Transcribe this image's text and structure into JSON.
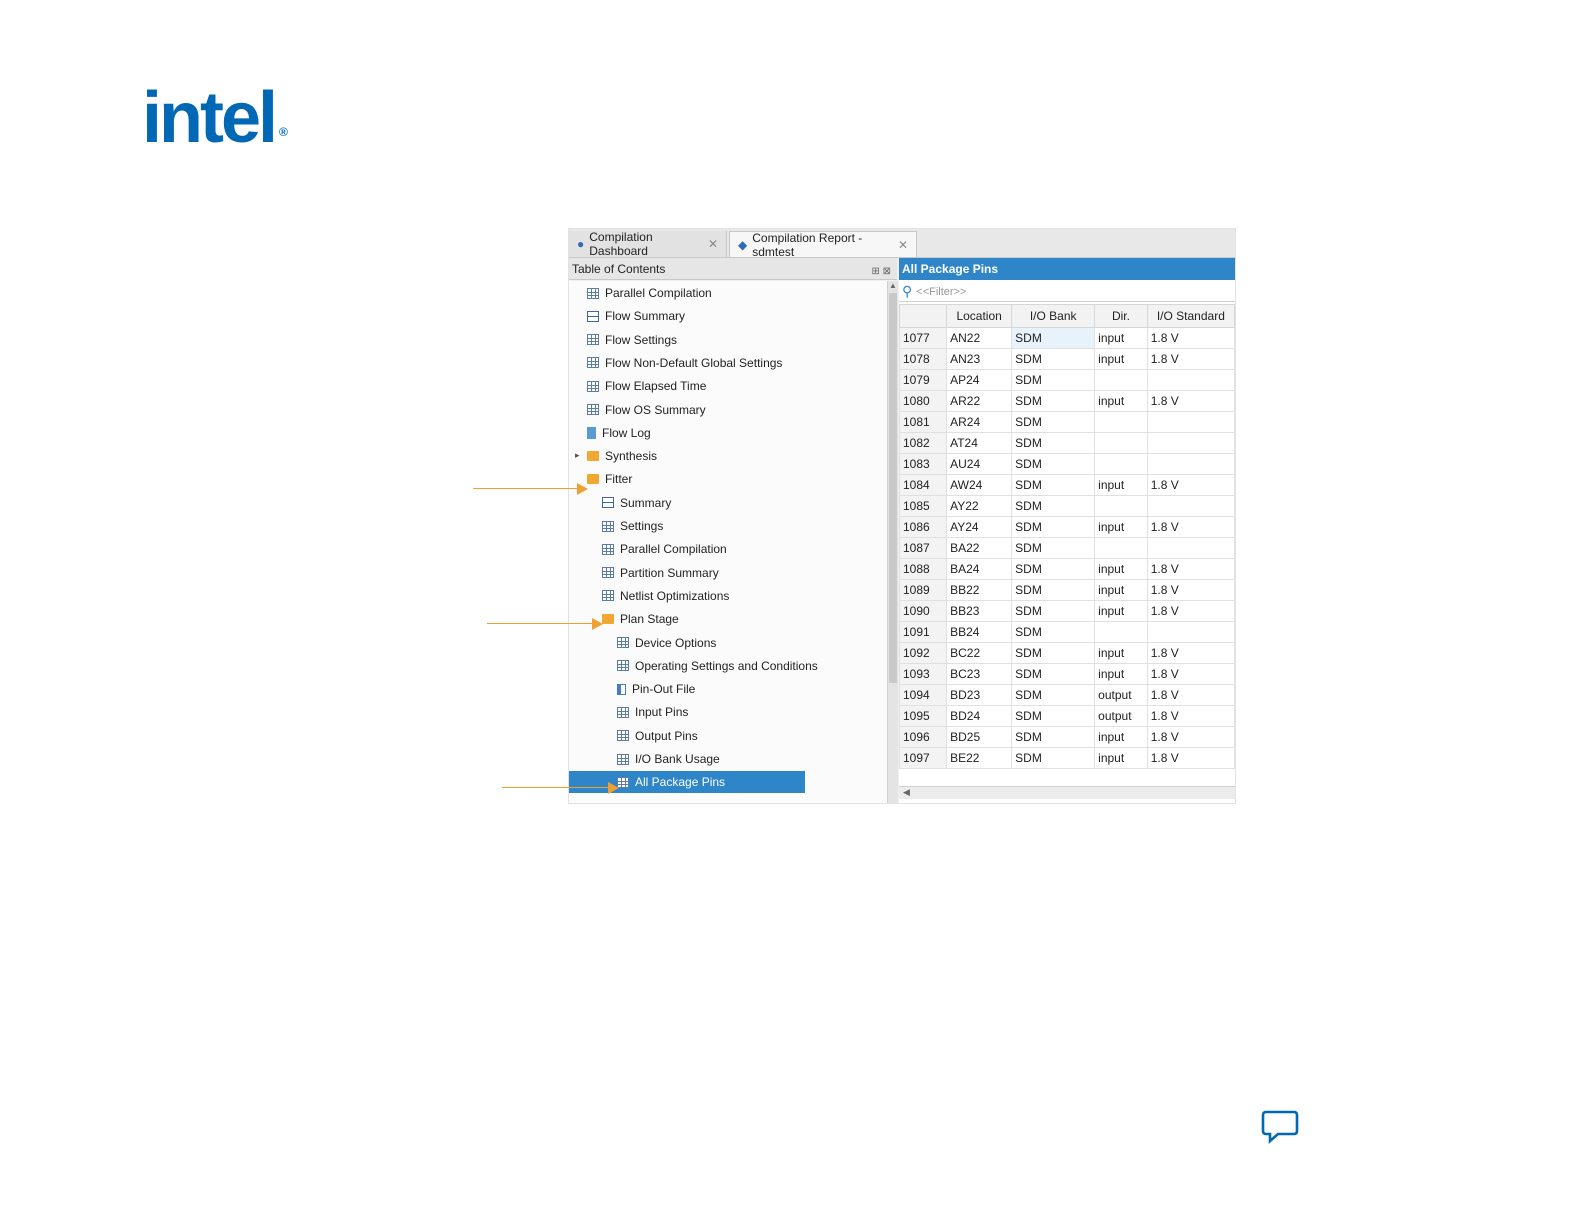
{
  "brand": {
    "logo_text": "intel",
    "logo_reg": "®",
    "color": "#0068b5"
  },
  "tabs": [
    {
      "label": "Compilation Dashboard",
      "icon": "dashboard-icon",
      "active": false
    },
    {
      "label": "Compilation Report - sdmtest",
      "icon": "report-icon",
      "active": true
    }
  ],
  "toc": {
    "title": "Table of Contents",
    "items": [
      {
        "label": "Parallel Compilation",
        "icon": "table-icon",
        "level": 0
      },
      {
        "label": "Flow Summary",
        "icon": "summary-icon",
        "level": 0
      },
      {
        "label": "Flow Settings",
        "icon": "table-icon",
        "level": 0
      },
      {
        "label": "Flow Non-Default Global Settings",
        "icon": "table-icon",
        "level": 0
      },
      {
        "label": "Flow Elapsed Time",
        "icon": "table-icon",
        "level": 0
      },
      {
        "label": "Flow OS Summary",
        "icon": "table-icon",
        "level": 0
      },
      {
        "label": "Flow Log",
        "icon": "doc-icon",
        "level": 0
      },
      {
        "label": "Synthesis",
        "icon": "folder-icon",
        "level": 0
      },
      {
        "label": "Fitter",
        "icon": "folder-icon",
        "level": 0
      },
      {
        "label": "Summary",
        "icon": "summary-icon",
        "level": 1
      },
      {
        "label": "Settings",
        "icon": "table-icon",
        "level": 1
      },
      {
        "label": "Parallel Compilation",
        "icon": "table-icon",
        "level": 1
      },
      {
        "label": "Partition Summary",
        "icon": "table-icon",
        "level": 1
      },
      {
        "label": "Netlist Optimizations",
        "icon": "table-icon",
        "level": 1
      },
      {
        "label": "Plan Stage",
        "icon": "folder-icon",
        "level": 1
      },
      {
        "label": "Device Options",
        "icon": "table-icon",
        "level": 2
      },
      {
        "label": "Operating Settings and Conditions",
        "icon": "table-icon",
        "level": 2
      },
      {
        "label": "Pin-Out File",
        "icon": "pinfile-icon",
        "level": 2
      },
      {
        "label": "Input Pins",
        "icon": "table-icon",
        "level": 2
      },
      {
        "label": "Output Pins",
        "icon": "table-icon",
        "level": 2
      },
      {
        "label": "I/O Bank Usage",
        "icon": "table-icon",
        "level": 2
      },
      {
        "label": "All Package Pins",
        "icon": "table-icon",
        "level": 2,
        "selected": true
      }
    ]
  },
  "report": {
    "title": "All Package Pins",
    "filter_placeholder": "<<Filter>>",
    "columns": [
      "",
      "Location",
      "I/O Bank",
      "Dir.",
      "I/O Standard"
    ],
    "rows": [
      [
        "1077",
        "AN22",
        "SDM",
        "input",
        "1.8 V"
      ],
      [
        "1078",
        "AN23",
        "SDM",
        "input",
        "1.8 V"
      ],
      [
        "1079",
        "AP24",
        "SDM",
        "",
        ""
      ],
      [
        "1080",
        "AR22",
        "SDM",
        "input",
        "1.8 V"
      ],
      [
        "1081",
        "AR24",
        "SDM",
        "",
        ""
      ],
      [
        "1082",
        "AT24",
        "SDM",
        "",
        ""
      ],
      [
        "1083",
        "AU24",
        "SDM",
        "",
        ""
      ],
      [
        "1084",
        "AW24",
        "SDM",
        "input",
        "1.8 V"
      ],
      [
        "1085",
        "AY22",
        "SDM",
        "",
        ""
      ],
      [
        "1086",
        "AY24",
        "SDM",
        "input",
        "1.8 V"
      ],
      [
        "1087",
        "BA22",
        "SDM",
        "",
        ""
      ],
      [
        "1088",
        "BA24",
        "SDM",
        "input",
        "1.8 V"
      ],
      [
        "1089",
        "BB22",
        "SDM",
        "input",
        "1.8 V"
      ],
      [
        "1090",
        "BB23",
        "SDM",
        "input",
        "1.8 V"
      ],
      [
        "1091",
        "BB24",
        "SDM",
        "",
        ""
      ],
      [
        "1092",
        "BC22",
        "SDM",
        "input",
        "1.8 V"
      ],
      [
        "1093",
        "BC23",
        "SDM",
        "input",
        "1.8 V"
      ],
      [
        "1094",
        "BD23",
        "SDM",
        "output",
        "1.8 V"
      ],
      [
        "1095",
        "BD24",
        "SDM",
        "output",
        "1.8 V"
      ],
      [
        "1096",
        "BD25",
        "SDM",
        "input",
        "1.8 V"
      ],
      [
        "1097",
        "BE22",
        "SDM",
        "input",
        "1.8 V"
      ]
    ]
  },
  "annotations": {
    "arrow_color": "#f0a030",
    "targets": [
      "Fitter",
      "Plan Stage",
      "All Package Pins"
    ]
  },
  "feedback": {
    "icon": "feedback-icon"
  }
}
